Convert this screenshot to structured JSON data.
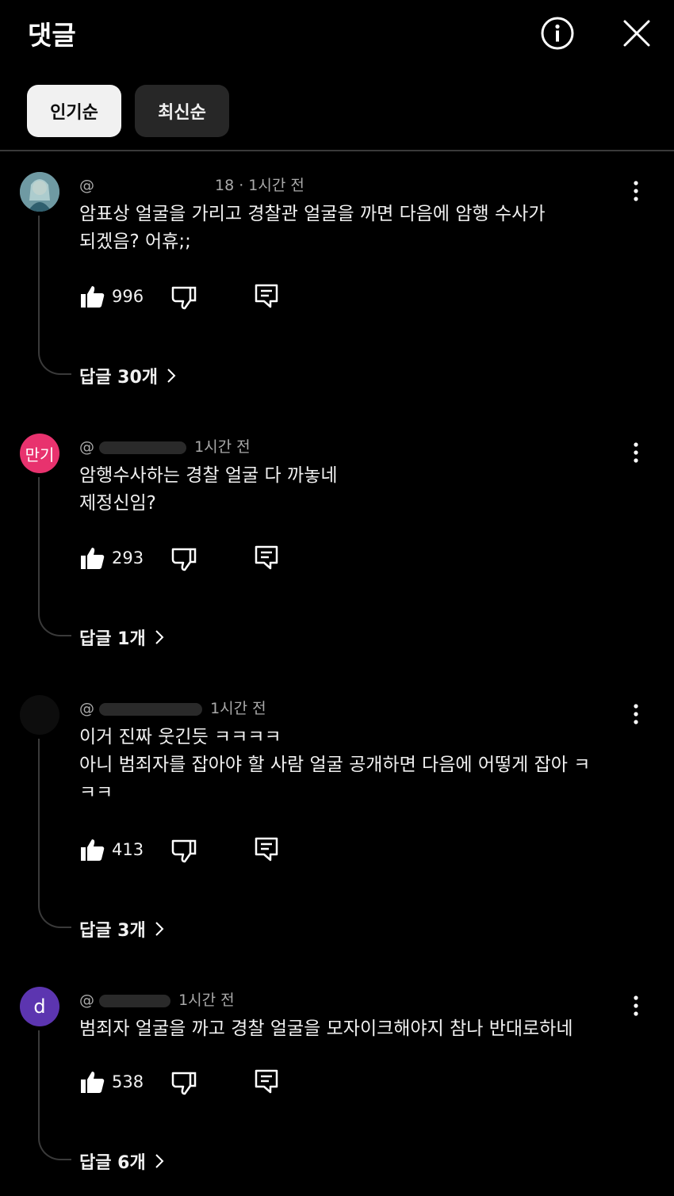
{
  "header": {
    "title": "댓글",
    "info_icon": "info-icon",
    "close_icon": "close-icon"
  },
  "tabs": [
    {
      "label": "인기순",
      "selected": true
    },
    {
      "label": "최신순",
      "selected": false
    }
  ],
  "comments": [
    {
      "meta": "@　　　　　　　　18 · 1시간 전",
      "time": "1시간 전",
      "text": "암표상 얼굴을 가리고 경찰관 얼굴을 까면 다음에 암행 수사가\n되겠음? 어휴;;",
      "likes": "996",
      "replies": "답글 30개",
      "avatar_color": "#5a7a86"
    },
    {
      "meta": "@",
      "time": "1시간 전",
      "text": "암행수사하는 경찰 얼굴 다 까놓네\n제정신임?",
      "likes": "293",
      "replies": "답글 1개",
      "avatar_text": "만기",
      "avatar_color": "#e8326e"
    },
    {
      "meta": "@",
      "time": "1시간 전",
      "text": "이거 진짜 웃긴듯 ㅋㅋㅋㅋ\n아니 범죄자를 잡아야 할 사람 얼굴 공개하면 다음에 어떻게 잡아 ㅋ\nㅋㅋ",
      "likes": "413",
      "replies": "답글 3개",
      "avatar_color": "#0d0d0d"
    },
    {
      "meta": "@",
      "time": "1시간 전",
      "text": "범죄자 얼굴을 까고 경찰 얼굴을 모자이크해야지 참나 반대로하네",
      "likes": "538",
      "replies": "답글 6개",
      "avatar_text": "d",
      "avatar_color": "#5c35b0"
    }
  ]
}
